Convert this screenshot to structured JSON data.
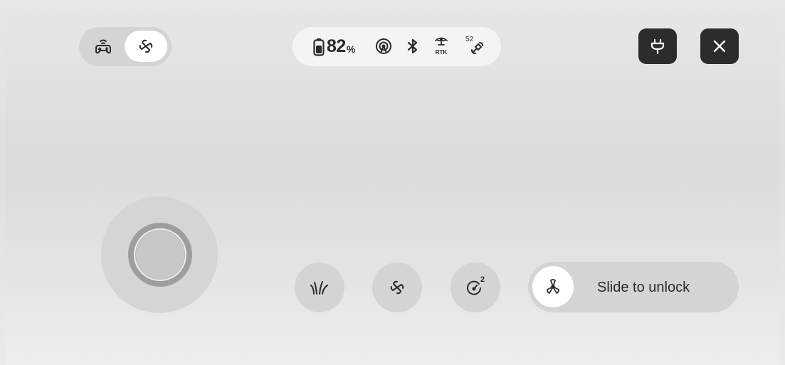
{
  "mode_toggle": {
    "options": [
      "gamepad",
      "fan"
    ],
    "selected": "fan"
  },
  "status": {
    "battery_value": "82",
    "battery_unit": "%",
    "rtk_label": "RTK",
    "satellite_count": "52",
    "icons": [
      "battery-icon",
      "signal-icon",
      "bluetooth-icon",
      "rtk-icon",
      "satellite-icon"
    ]
  },
  "actions": {
    "buttons": [
      "sprinkler-icon",
      "fan-icon",
      "speed-gauge-icon"
    ],
    "gauge_superscript": "2"
  },
  "slider": {
    "label": "Slide to unlock"
  },
  "top_buttons": [
    "plug-icon",
    "close-icon"
  ],
  "colors": {
    "dark_button": "#2c2c2c",
    "pill_bg": "#f3f4f4",
    "control_bg": "#d3d5d5"
  }
}
